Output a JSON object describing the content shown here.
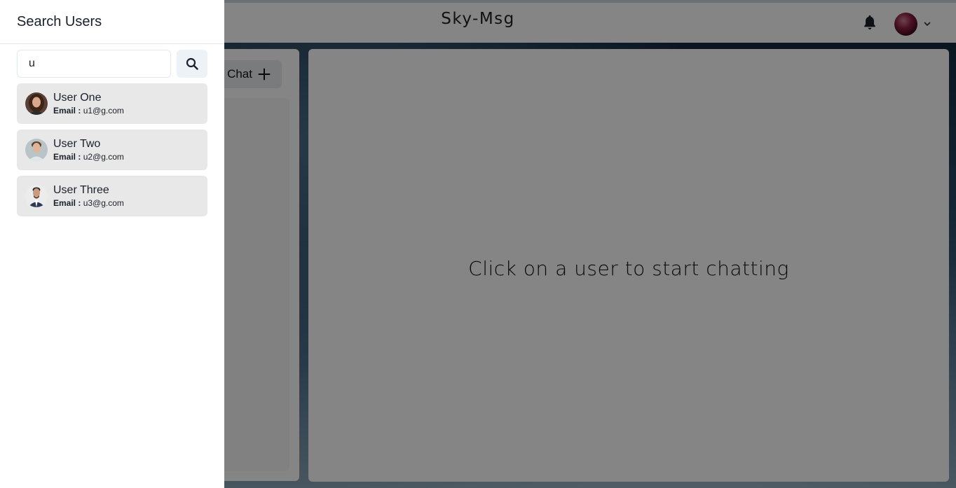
{
  "app": {
    "title": "Sky-Msg"
  },
  "header": {
    "notification_icon": "bell-icon",
    "profile_icon": "chevron-down-icon"
  },
  "chats": {
    "new_chat_label": "Chat"
  },
  "chat_box": {
    "empty_message": "Click on a user to start chatting"
  },
  "drawer": {
    "title": "Search Users",
    "search": {
      "value": "u",
      "button_icon": "search-icon"
    },
    "users": [
      {
        "name": "User One",
        "email_label": "Email :",
        "email": "u1@g.com"
      },
      {
        "name": "User Two",
        "email_label": "Email :",
        "email": "u2@g.com"
      },
      {
        "name": "User Three",
        "email_label": "Email :",
        "email": "u3@g.com"
      }
    ]
  },
  "colors": {
    "overlay": "#00000080",
    "list_item_bg": "#e8e8e8",
    "button_bg": "#edf2f7"
  }
}
